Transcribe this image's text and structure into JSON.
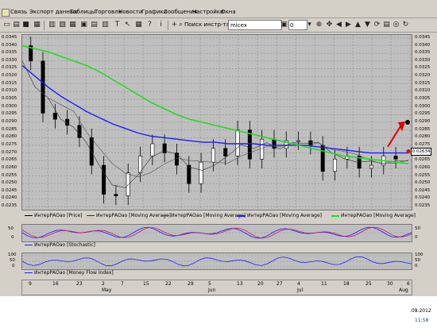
{
  "menu": {
    "items": [
      "Связь",
      "Экспорт данных",
      "Таблицы",
      "Торговля",
      "Новости",
      "Графики",
      "Сообщения",
      "Настройки",
      "Окна"
    ]
  },
  "toolbar": {
    "search_label": "Поиск инстр-та",
    "search_value": "micex",
    "zoom_value": "0"
  },
  "chart": {
    "price_box": "0.02634",
    "y_ticks": [
      "0.0345",
      "0.0340",
      "0.0335",
      "0.0330",
      "0.0325",
      "0.0320",
      "0.0315",
      "0.0310",
      "0.0305",
      "0.0300",
      "0.0295",
      "0.0290",
      "0.0285",
      "0.0280",
      "0.0275",
      "0.0270",
      "0.0265",
      "0.0260",
      "0.0255",
      "0.0250",
      "0.0245",
      "0.0240",
      "0.0235"
    ],
    "legend": [
      {
        "label": "ИнтерРАОао [Price]",
        "color": "#000000"
      },
      {
        "label": "ИнтерРАОао [Moving Average]",
        "color": "#333333"
      },
      {
        "label": "ИнтерРАОао [Moving Average]",
        "color": "#555555"
      },
      {
        "label": "ИнтерРАОао [Moving Average]",
        "color": "#1c1cff"
      },
      {
        "label": "ИнтерРАОао [Moving Average]",
        "color": "#22dd22"
      }
    ]
  },
  "stochastic": {
    "ticks": [
      "50",
      "0"
    ],
    "legend": "ИнтерРАОао [Stochastic]"
  },
  "mfi": {
    "ticks": [
      "100",
      "50",
      "0"
    ],
    "legend": "ИнтерРАОао [Money Flow Index]"
  },
  "dates": {
    "days": [
      "9",
      "16",
      "23",
      "2",
      "7",
      "15",
      "22",
      "29",
      "5",
      "13",
      "20",
      "27",
      "4",
      "11",
      "18",
      "25",
      "30",
      "6"
    ],
    "months": [
      "May",
      "Jun",
      "Jul",
      "Aug"
    ]
  },
  "taskbar": {
    "date": ".08.2012",
    "time": "11:58"
  },
  "chart_data": {
    "type": "line",
    "series": [
      {
        "values": [
          0.033,
          0.0296,
          0.0292,
          0.0288,
          0.028,
          0.0262,
          0.0243,
          0.0242,
          0.0257,
          0.0268,
          0.0276,
          0.027,
          0.0262,
          0.025,
          0.0264,
          0.0273,
          0.0268,
          0.0285,
          0.0266,
          0.0279,
          0.0273,
          0.0278,
          0.0278,
          0.0275,
          0.0258,
          0.0266,
          0.0268,
          0.026,
          0.0262,
          0.0268,
          0.0266
        ]
      },
      {
        "values": [
          0.034,
          0.0338,
          0.0336,
          0.0333,
          0.033,
          0.0327,
          0.0323,
          0.0318,
          0.0313,
          0.0308,
          0.0303,
          0.0299,
          0.0295,
          0.0292,
          0.029,
          0.0288,
          0.0286,
          0.0284,
          0.0282,
          0.028,
          0.0278,
          0.0276,
          0.0274,
          0.0272,
          0.027,
          0.0268,
          0.0267,
          0.0266,
          0.0265,
          0.0264,
          0.0263
        ]
      },
      {
        "values": [
          0.0327,
          0.032,
          0.0313,
          0.0307,
          0.0302,
          0.0297,
          0.0293,
          0.0289,
          0.0286,
          0.0283,
          0.0281,
          0.028,
          0.0279,
          0.0278,
          0.0277,
          0.0277,
          0.0276,
          0.0276,
          0.0276,
          0.0275,
          0.0275,
          0.0275,
          0.0275,
          0.0274,
          0.0273,
          0.0272,
          0.0271,
          0.027,
          0.027,
          0.027,
          0.027
        ]
      }
    ],
    "ylim": [
      0.0233,
      0.0347
    ]
  }
}
